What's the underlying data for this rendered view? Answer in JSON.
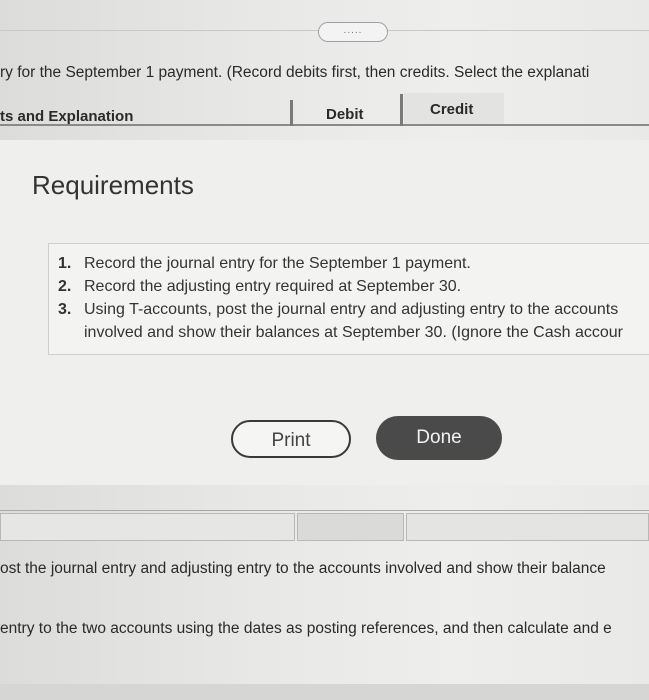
{
  "top_toolbar": {
    "pill_label": "....."
  },
  "journal": {
    "instruction": "ry for the September 1 payment. (Record debits first, then credits. Select the explanati",
    "headers": {
      "explanation": "ts and Explanation",
      "debit": "Debit",
      "credit": "Credit"
    }
  },
  "requirements_dialog": {
    "title": "Requirements",
    "items": [
      {
        "number": "1.",
        "line1": "Record the journal entry for the September 1 payment."
      },
      {
        "number": "2.",
        "line1": "Record the adjusting entry required at September 30."
      },
      {
        "number": "3.",
        "line1": "Using T-accounts, post the journal entry and adjusting entry to the accounts",
        "line2": "involved and show their balances at September 30. (Ignore the Cash accour"
      }
    ],
    "print_label": "Print",
    "done_label": "Done"
  },
  "lower_section": {
    "text1": "ost the journal entry and adjusting entry to the accounts involved and show their balance",
    "text2": "entry to the two accounts using the dates as posting references, and then calculate and e"
  }
}
